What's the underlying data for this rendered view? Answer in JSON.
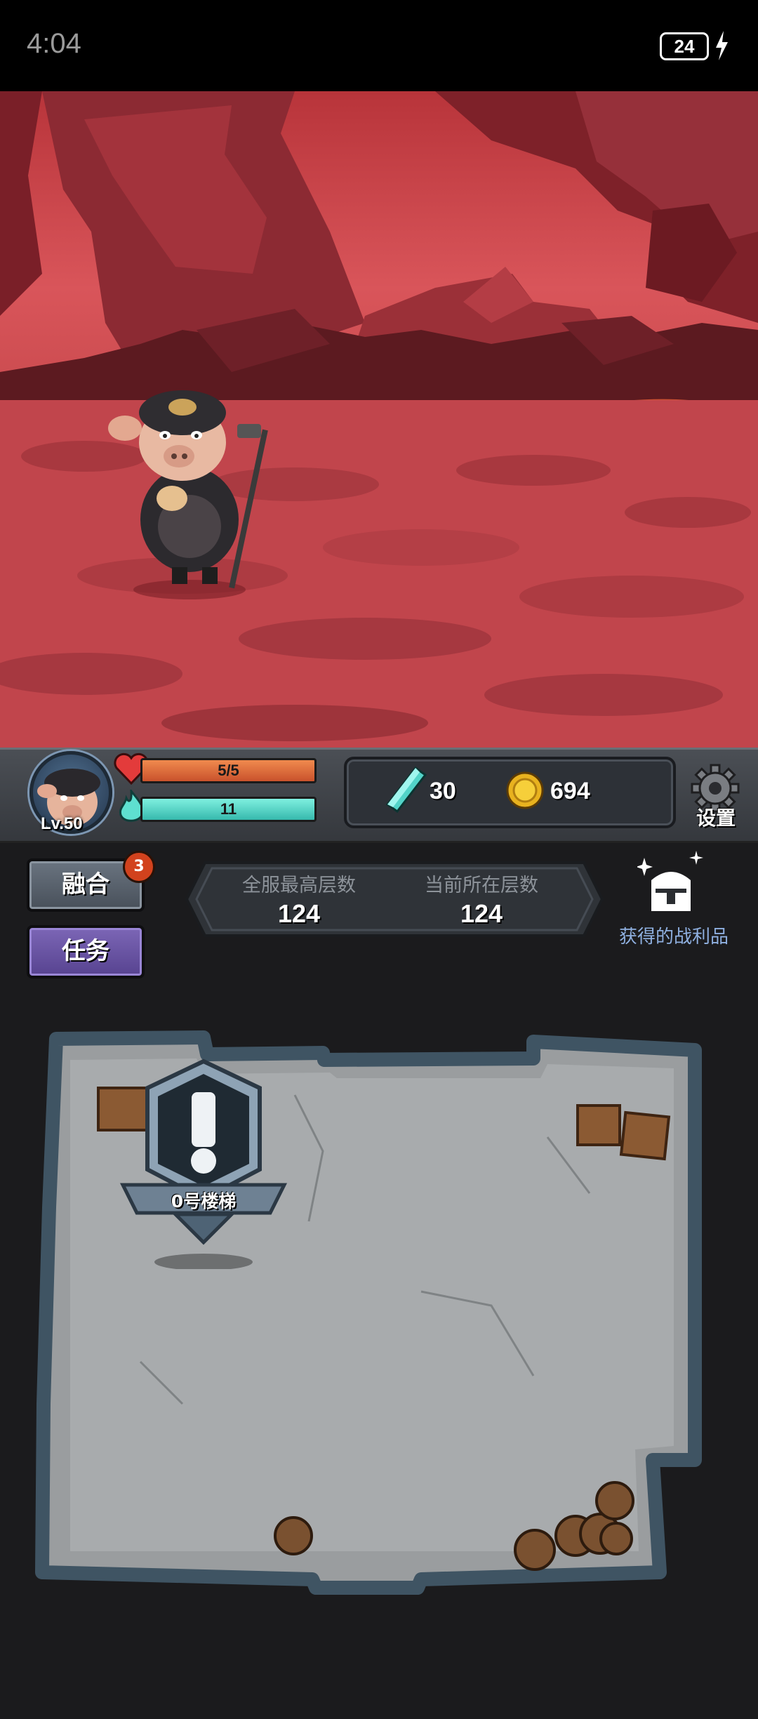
{
  "status_bar": {
    "time": "4:04",
    "battery": "24",
    "icons": [
      "battery-icon",
      "charging-bolt-icon"
    ]
  },
  "player": {
    "level": "Lv.50",
    "hp": "5/5",
    "mp": "11"
  },
  "currency": {
    "gems": "30",
    "coins": "694"
  },
  "settings": {
    "label": "设置"
  },
  "buttons": {
    "fuse": "融合",
    "fuse_badge": "3",
    "quest": "任务"
  },
  "floor": {
    "server_best_label": "全服最高层数",
    "server_best_value": "124",
    "current_label": "当前所在层数",
    "current_value": "124"
  },
  "loot": {
    "label": "获得的战利品"
  },
  "map": {
    "stair_label": "0号楼梯"
  },
  "colors": {
    "hp": "#e0703f",
    "mp": "#5fdccd",
    "quest": "#6a52a3",
    "loot_text": "#8fb0e0",
    "scene": "#c94a4e"
  }
}
